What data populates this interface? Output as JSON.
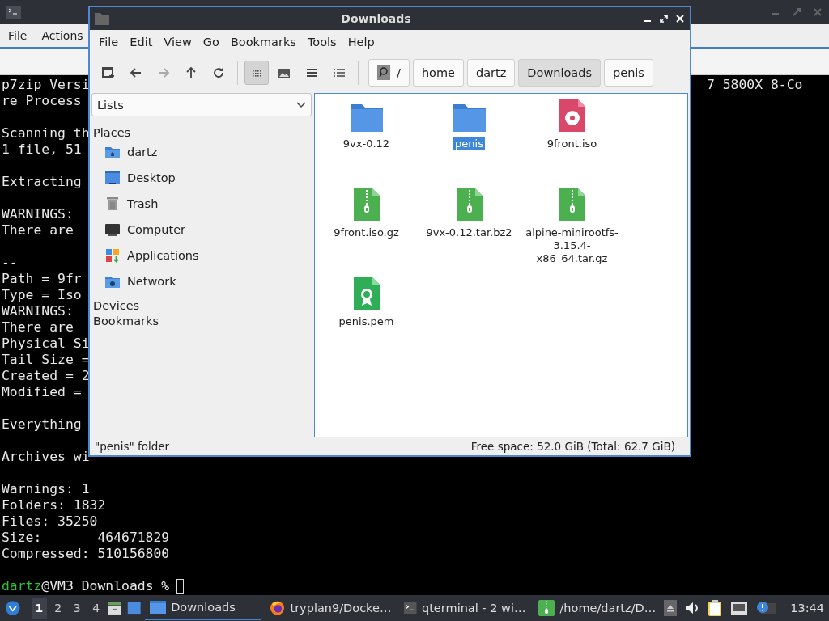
{
  "terminal": {
    "menu": [
      "File",
      "Actions"
    ],
    "paragraphs": [
      [
        "p7zip Versi",
        "re Process"
      ],
      [
        "Scanning th",
        "1 file, 51"
      ],
      [
        "Extracting"
      ],
      [
        "WARNINGS:",
        "There are"
      ],
      [
        "--",
        "Path = 9fr",
        "Type = Iso",
        "WARNINGS:",
        "There are",
        "Physical Si",
        "Tail Size =",
        "Created = 2",
        "Modified ="
      ],
      [
        "Everything"
      ],
      [
        "Archives wi"
      ],
      [
        "Warnings: 1",
        "Folders: 1832",
        "Files: 35250",
        "Size:       464671829",
        "Compressed: 510156800"
      ]
    ],
    "right_fragment": "7 5800X 8-Co",
    "prompt": {
      "user": "dartz",
      "rest": "@VM3 Downloads %"
    }
  },
  "file_manager": {
    "title": "Downloads",
    "menu": [
      "File",
      "Edit",
      "View",
      "Go",
      "Bookmarks",
      "Tools",
      "Help"
    ],
    "toolbar": [
      {
        "kind": "new-tab",
        "disabled": false
      },
      {
        "kind": "back",
        "disabled": false
      },
      {
        "kind": "forward",
        "disabled": true
      },
      {
        "kind": "up",
        "disabled": false
      },
      {
        "kind": "reload",
        "disabled": false
      }
    ],
    "views": [
      {
        "kind": "icons",
        "selected": true
      },
      {
        "kind": "thumbnails",
        "selected": false
      },
      {
        "kind": "compact",
        "selected": false
      },
      {
        "kind": "detailed",
        "selected": false
      }
    ],
    "path": [
      {
        "label": "/",
        "kind": "root",
        "selected": false
      },
      {
        "label": "home",
        "selected": false
      },
      {
        "label": "dartz",
        "selected": false
      },
      {
        "label": "Downloads",
        "selected": true
      },
      {
        "label": "penis",
        "selected": false
      }
    ],
    "side_pane": {
      "mode": "Lists",
      "sections": [
        {
          "title": "Places",
          "items": [
            {
              "label": "dartz",
              "kind": "home"
            },
            {
              "label": "Desktop",
              "kind": "desktop"
            },
            {
              "label": "Trash",
              "kind": "trash"
            },
            {
              "label": "Computer",
              "kind": "computer"
            },
            {
              "label": "Applications",
              "kind": "applications"
            },
            {
              "label": "Network",
              "kind": "network"
            }
          ]
        },
        {
          "title": "Devices"
        },
        {
          "title": "Bookmarks"
        }
      ]
    },
    "files": [
      {
        "name": "9vx-0.12",
        "kind": "folder",
        "selected": false
      },
      {
        "name": "penis",
        "kind": "folder",
        "selected": true
      },
      {
        "name": "9front.iso",
        "kind": "disc",
        "selected": false
      },
      {
        "name": "9front.iso.gz",
        "kind": "archive",
        "selected": false
      },
      {
        "name": "9vx-0.12.tar.bz2",
        "kind": "archive",
        "selected": false
      },
      {
        "name": "alpine-minirootfs-3.15.4-x86_64.tar.gz",
        "kind": "archive",
        "selected": false
      },
      {
        "name": "penis.pem",
        "kind": "certificate",
        "selected": false
      }
    ],
    "status": {
      "selection": "\"penis\" folder",
      "free_space": "Free space: 52.0 GiB (Total: 62.7 GiB)"
    }
  },
  "taskbar": {
    "workspaces": [
      {
        "label": "1",
        "selected": true
      },
      {
        "label": "2",
        "selected": false
      },
      {
        "label": "3",
        "selected": false
      },
      {
        "label": "4",
        "selected": false
      }
    ],
    "tasks": [
      {
        "label": "Downloads",
        "kind": "folder",
        "selected": true
      },
      {
        "label": "tryplan9/Docke…",
        "kind": "browser",
        "selected": false
      },
      {
        "label": "qterminal - 2 wi…",
        "kind": "terminal",
        "selected": false
      },
      {
        "label": "/home/dartz/D…",
        "kind": "archive",
        "selected": false
      }
    ],
    "clock": "13:44"
  }
}
